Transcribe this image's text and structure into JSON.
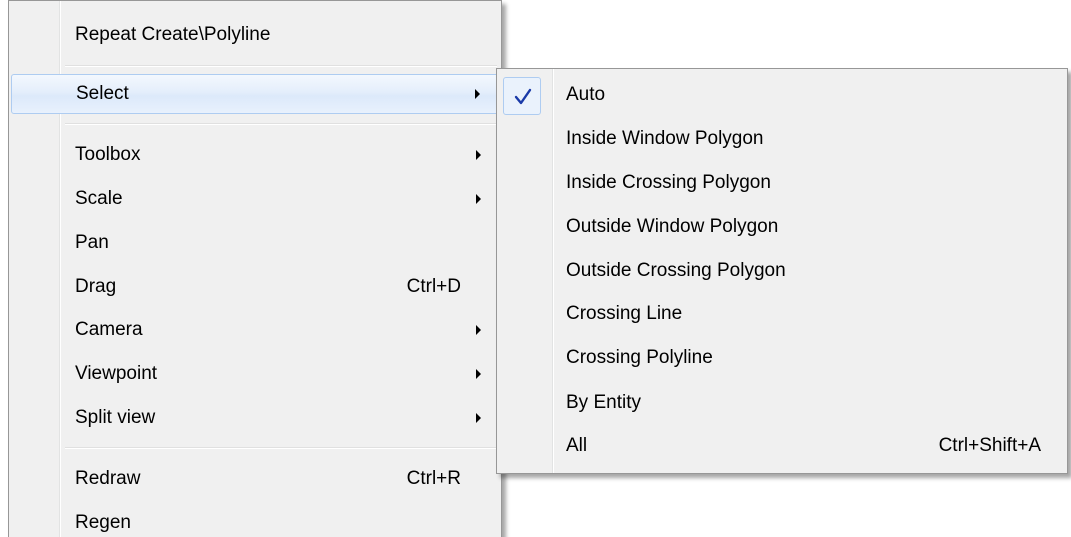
{
  "main_menu": {
    "items": [
      {
        "label": "Repeat Create\\Polyline"
      },
      {
        "label": "Select"
      },
      {
        "label": "Toolbox"
      },
      {
        "label": "Scale"
      },
      {
        "label": "Pan"
      },
      {
        "label": "Drag",
        "shortcut": "Ctrl+D"
      },
      {
        "label": "Camera"
      },
      {
        "label": "Viewpoint"
      },
      {
        "label": "Split view"
      },
      {
        "label": "Redraw",
        "shortcut": "Ctrl+R"
      },
      {
        "label": "Regen"
      }
    ]
  },
  "select_submenu": {
    "items": [
      {
        "label": "Auto",
        "checked": true
      },
      {
        "label": "Inside Window Polygon"
      },
      {
        "label": "Inside Crossing Polygon"
      },
      {
        "label": "Outside Window Polygon"
      },
      {
        "label": "Outside Crossing Polygon"
      },
      {
        "label": "Crossing Line"
      },
      {
        "label": "Crossing Polyline"
      },
      {
        "label": "By Entity"
      },
      {
        "label": "All",
        "shortcut": "Ctrl+Shift+A"
      }
    ]
  },
  "colors": {
    "menu_background": "#f0f0f0",
    "highlight_border": "#aeccf1",
    "check_color": "#1a3aa8"
  },
  "icons": {
    "submenu_arrow": "submenu-arrow-icon",
    "check": "checkmark-icon"
  }
}
